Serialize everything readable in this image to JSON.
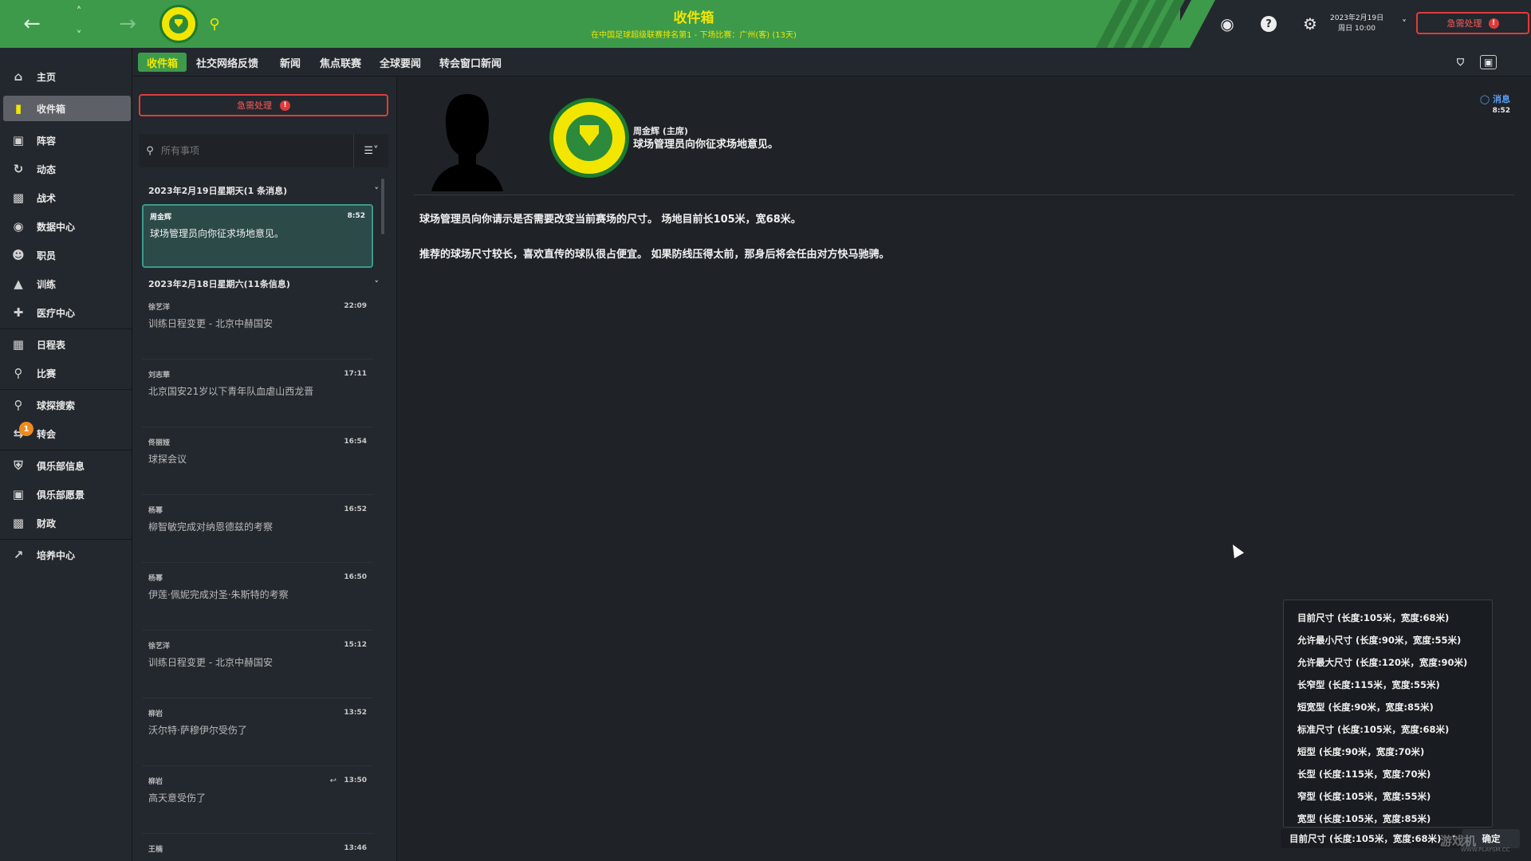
{
  "header": {
    "title": "收件箱",
    "subtitle": "在中国足球超级联赛排名第1 - 下场比赛：广州(客) (13天)",
    "date_line1": "2023年2月19日",
    "date_line2": "周日 10:00",
    "urgent_label": "急需处理",
    "icons": [
      "back-arrow-icon",
      "up-chevron-icon",
      "down-chevron-icon",
      "forward-arrow-icon",
      "club-badge",
      "search-icon",
      "globe-icon",
      "help-icon",
      "gear-icon",
      "chevron-down-icon"
    ],
    "colors": {
      "brand_green": "#3d9a4a",
      "brand_yellow": "#f2e600",
      "urgent_red": "#e03b3b"
    }
  },
  "sidebar": {
    "items": [
      {
        "label": "主页",
        "icon": "home-icon"
      },
      {
        "label": "收件箱",
        "icon": "inbox-icon",
        "active": true
      },
      {
        "label": "阵容",
        "icon": "shirt-icon"
      },
      {
        "label": "动态",
        "icon": "dynamics-icon"
      },
      {
        "label": "战术",
        "icon": "tactics-icon"
      },
      {
        "label": "数据中心",
        "icon": "data-hub-icon"
      },
      {
        "label": "职员",
        "icon": "staff-icon"
      },
      {
        "label": "训练",
        "icon": "training-icon"
      },
      {
        "label": "医疗中心",
        "icon": "medical-icon"
      },
      {
        "label": "日程表",
        "icon": "calendar-icon"
      },
      {
        "label": "比赛",
        "icon": "trophy-icon"
      },
      {
        "label": "球探搜索",
        "icon": "scout-search-icon"
      },
      {
        "label": "转会",
        "icon": "transfer-icon",
        "badge": "1"
      },
      {
        "label": "俱乐部信息",
        "icon": "shield-icon"
      },
      {
        "label": "俱乐部愿景",
        "icon": "vision-icon"
      },
      {
        "label": "财政",
        "icon": "finance-icon"
      },
      {
        "label": "培养中心",
        "icon": "development-icon"
      }
    ]
  },
  "tabs": [
    "收件箱",
    "社交网络反馈",
    "新闻",
    "焦点联赛",
    "全球要闻",
    "转会窗口新闻"
  ],
  "inbox": {
    "urgent_label": "急需处理",
    "search_placeholder": "所有事项",
    "groups": [
      {
        "title": "2023年2月19日星期天(1 条消息)"
      },
      {
        "title": "2023年2月18日星期六(11条信息)"
      }
    ],
    "messages": [
      {
        "sender": "周金辉",
        "time": "8:52",
        "subject": "球场管理员向你征求场地意见。"
      },
      {
        "sender": "徐艺洋",
        "time": "22:09",
        "subject": "训练日程变更 - 北京中赫国安"
      },
      {
        "sender": "刘志華",
        "time": "17:11",
        "subject": "北京国安21岁以下青年队血虐山西龙晋"
      },
      {
        "sender": "佟丽娅",
        "time": "16:54",
        "subject": "球探会议"
      },
      {
        "sender": "杨幂",
        "time": "16:52",
        "subject": "柳智敏完成对纳恩德兹的考察"
      },
      {
        "sender": "杨幂",
        "time": "16:50",
        "subject": "伊莲·佩妮完成对圣·朱斯特的考察"
      },
      {
        "sender": "徐艺洋",
        "time": "15:12",
        "subject": "训练日程变更 - 北京中赫国安"
      },
      {
        "sender": "柳岩",
        "time": "13:52",
        "subject": "沃尔特·萨穆伊尔受伤了"
      },
      {
        "sender": "柳岩",
        "time": "13:50",
        "subject": "高天意受伤了"
      },
      {
        "sender": "王楠",
        "time": "13:46",
        "subject": ""
      }
    ]
  },
  "message": {
    "from": "周金辉 (主席)",
    "subject": "球场管理员向你征求场地意见。",
    "tag": "消息",
    "time": "8:52",
    "paragraph1": "球场管理员向你请示是否需要改变当前赛场的尺寸。 场地目前长105米，宽68米。",
    "paragraph2": "推荐的球场尺寸较长，喜欢直传的球队很占便宜。 如果防线压得太前，那身后将会任由对方快马驰骋。"
  },
  "pitch_options": [
    "目前尺寸 (长度:105米，宽度:68米)",
    "允许最小尺寸 (长度:90米，宽度:55米)",
    "允许最大尺寸 (长度:120米，宽度:90米)",
    "长窄型 (长度:115米，宽度:55米)",
    "短宽型 (长度:90米，宽度:85米)",
    "标准尺寸 (长度:105米，宽度:68米)",
    "短型 (长度:90米，宽度:70米)",
    "长型 (长度:115米，宽度:70米)",
    "窄型 (长度:105米，宽度:55米)",
    "宽型 (长度:105米，宽度:85米)"
  ],
  "pitch_select_value": "目前尺寸 (长度:105米，宽度:68米)",
  "confirm_label": "确定",
  "watermark": "游戏机",
  "watermark_url": "WWW.PLAYSM.CC"
}
